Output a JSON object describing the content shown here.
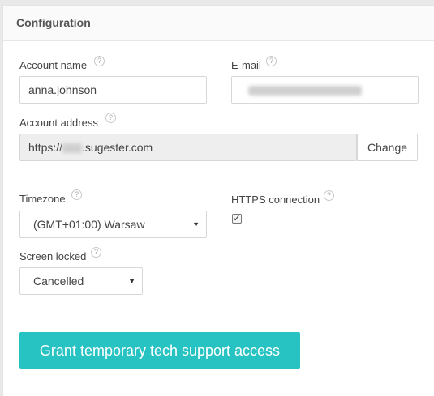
{
  "panel": {
    "title": "Configuration"
  },
  "help_glyph": "?",
  "account_name": {
    "label": "Account name",
    "value": "anna.johnson"
  },
  "email": {
    "label": "E-mail",
    "value": ""
  },
  "account_address": {
    "label": "Account address",
    "prefix": "https://",
    "suffix": ".sugester.com",
    "change_label": "Change"
  },
  "timezone": {
    "label": "Timezone",
    "selected": "(GMT+01:00) Warsaw"
  },
  "https": {
    "label": "HTTPS connection",
    "checked": true,
    "check_glyph": "✓"
  },
  "screen_locked": {
    "label": "Screen locked",
    "selected": "Cancelled"
  },
  "caret_glyph": "▼",
  "grant_button": {
    "label": "Grant temporary tech support access"
  },
  "colors": {
    "accent": "#27c2c2"
  }
}
